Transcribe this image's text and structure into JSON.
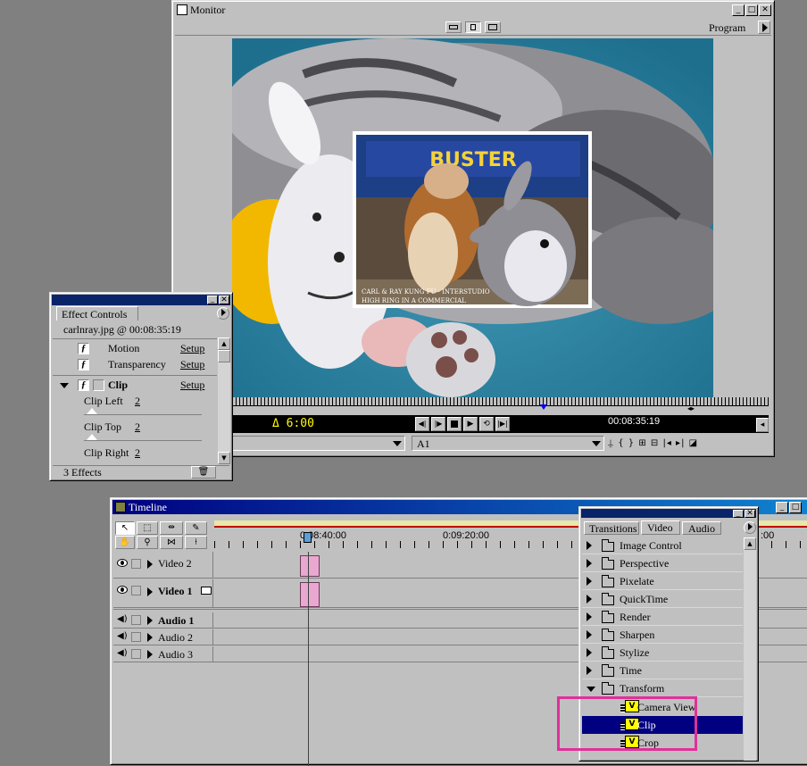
{
  "monitor": {
    "title": "Monitor",
    "view_label": "Program",
    "time_left": "Δ 6:00",
    "time_right": "00:08:35:19",
    "track_select": "A1",
    "icon_name": "monitor-window-icon"
  },
  "effect_controls": {
    "tab_label": "Effect Controls",
    "clip_info": "carlnray.jpg @ 00:08:35:19",
    "effects": [
      {
        "name": "Motion",
        "setup": "Setup"
      },
      {
        "name": "Transparency",
        "setup": "Setup"
      }
    ],
    "clip_effect": {
      "name": "Clip",
      "setup": "Setup"
    },
    "params": [
      {
        "label": "Clip Left",
        "value": "2"
      },
      {
        "label": "Clip Top",
        "value": "2"
      },
      {
        "label": "Clip Right",
        "value": "2"
      }
    ],
    "footer": "3 Effects"
  },
  "timeline": {
    "title": "Timeline",
    "ruler_labels": [
      "0:08:40:00",
      "0:09:20:00",
      ":00"
    ],
    "tracks": [
      {
        "name": "Video 2",
        "type": "video"
      },
      {
        "name": "Video 1",
        "type": "video"
      },
      {
        "name": "Audio 1",
        "type": "audio"
      },
      {
        "name": "Audio 2",
        "type": "audio"
      },
      {
        "name": "Audio 3",
        "type": "audio"
      }
    ]
  },
  "transitions": {
    "tabs": [
      "Transitions",
      "Video",
      "Audio"
    ],
    "folders": [
      "Image Control",
      "Perspective",
      "Pixelate",
      "QuickTime",
      "Render",
      "Sharpen",
      "Stylize",
      "Time",
      "Transform"
    ],
    "items": [
      "Camera View",
      "Clip",
      "Crop"
    ],
    "selected_item": "Clip"
  },
  "inset_photo_caption": [
    "CARL & RAY KUNG FU · INTERSTUDIO",
    "HIGH RING IN A COMMERCIAL"
  ],
  "inset_photo_sign": "BUSTER",
  "colors": {
    "highlight_box": "#e0309a",
    "selection": "#000080",
    "clip_block": "#e8a8d0"
  }
}
